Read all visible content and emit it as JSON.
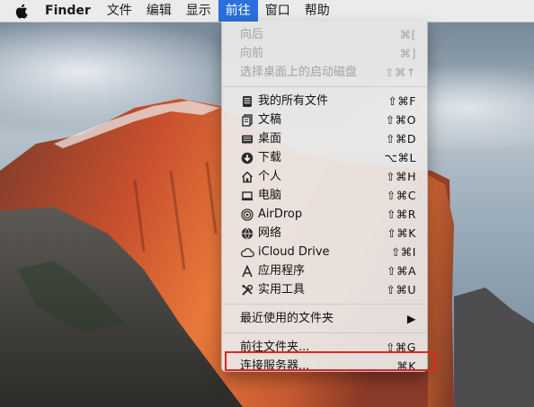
{
  "menubar": {
    "app_name": "Finder",
    "menus": [
      "文件",
      "编辑",
      "显示",
      "前往",
      "窗口",
      "帮助"
    ],
    "active_menu": "前往"
  },
  "go_menu": {
    "nav": [
      {
        "label": "向后",
        "shortcut": "⌘[",
        "enabled": false
      },
      {
        "label": "向前",
        "shortcut": "⌘]",
        "enabled": false
      },
      {
        "label": "选择桌面上的启动磁盘",
        "shortcut": "⇧⌘↑",
        "enabled": false
      }
    ],
    "places": [
      {
        "icon": "all-files-icon",
        "label": "我的所有文件",
        "shortcut": "⇧⌘F"
      },
      {
        "icon": "documents-icon",
        "label": "文稿",
        "shortcut": "⇧⌘O"
      },
      {
        "icon": "desktop-icon",
        "label": "桌面",
        "shortcut": "⇧⌘D"
      },
      {
        "icon": "downloads-icon",
        "label": "下载",
        "shortcut": "⌥⌘L"
      },
      {
        "icon": "home-icon",
        "label": "个人",
        "shortcut": "⇧⌘H"
      },
      {
        "icon": "computer-icon",
        "label": "电脑",
        "shortcut": "⇧⌘C"
      },
      {
        "icon": "airdrop-icon",
        "label": "AirDrop",
        "shortcut": "⇧⌘R"
      },
      {
        "icon": "network-icon",
        "label": "网络",
        "shortcut": "⇧⌘K"
      },
      {
        "icon": "icloud-icon",
        "label": "iCloud Drive",
        "shortcut": "⇧⌘I"
      },
      {
        "icon": "applications-icon",
        "label": "应用程序",
        "shortcut": "⇧⌘A"
      },
      {
        "icon": "utilities-icon",
        "label": "实用工具",
        "shortcut": "⇧⌘U"
      }
    ],
    "recent_folders": {
      "label": "最近使用的文件夹",
      "submenu_arrow": "▶"
    },
    "goto_folder": {
      "label": "前往文件夹...",
      "shortcut": "⇧⌘G"
    },
    "connect_server": {
      "label": "连接服务器...",
      "shortcut": "⌘K"
    }
  },
  "colors": {
    "menu_highlight": "#2a6fdb",
    "annotation_box": "#e0271f"
  }
}
